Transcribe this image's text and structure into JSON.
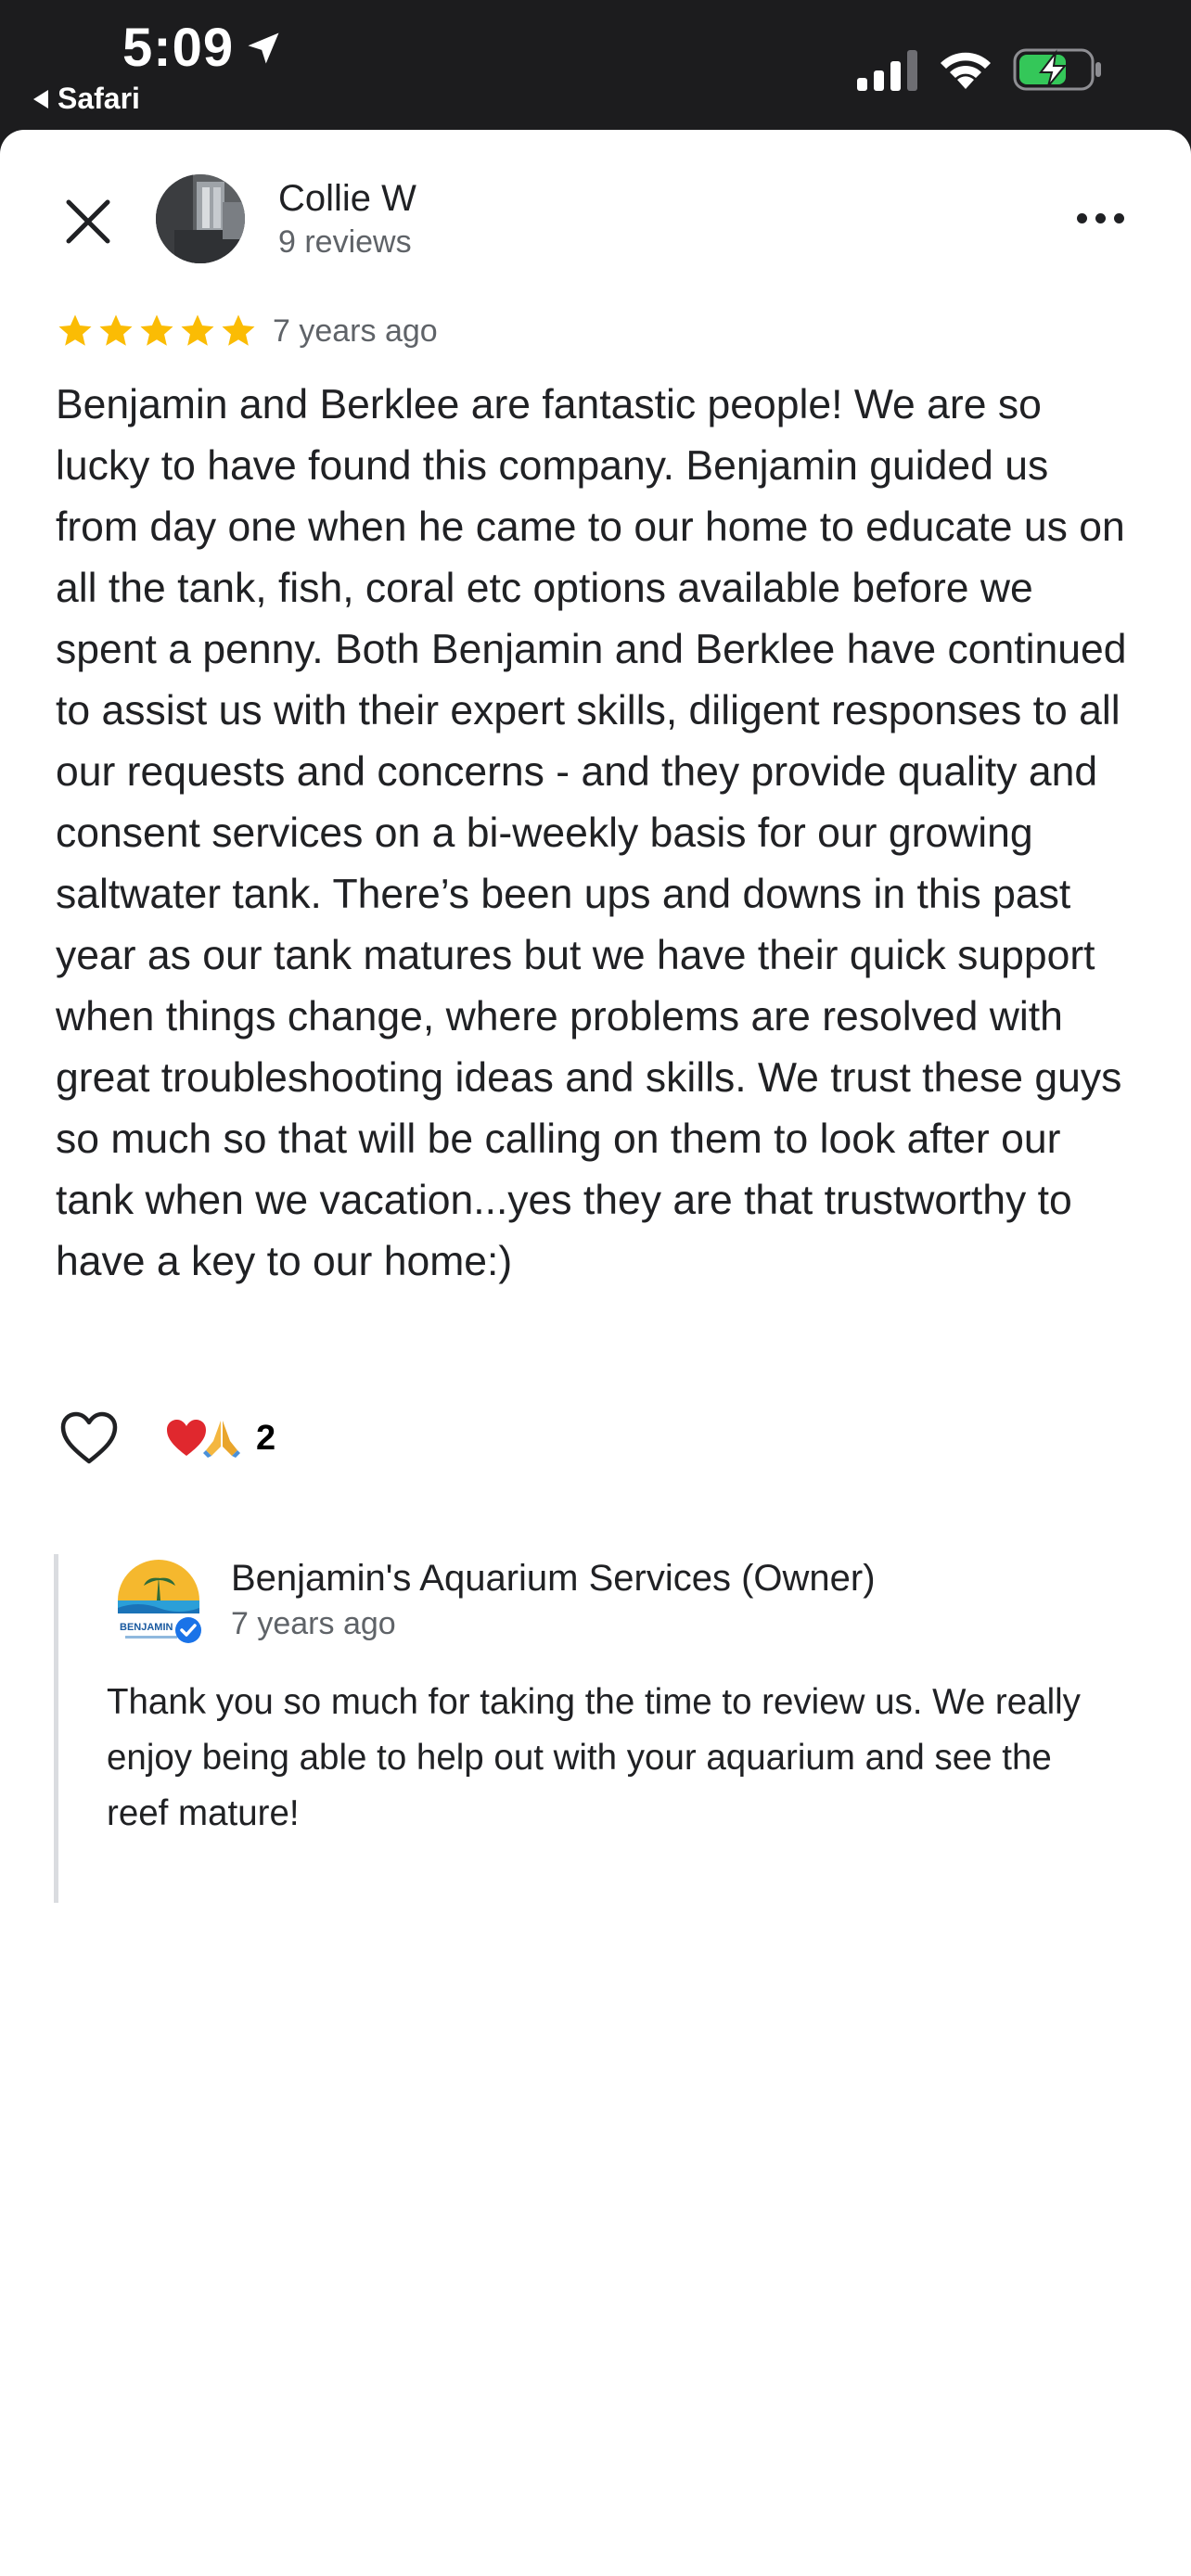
{
  "status_bar": {
    "time": "5:09",
    "back_app": "Safari"
  },
  "review": {
    "reviewer_name": "Collie W",
    "reviewer_reviews": "9 reviews",
    "rating": 5,
    "max_rating": 5,
    "age": "7 years ago",
    "text": "Benjamin and Berklee are fantastic people! We are so lucky to have found this company. Benjamin guided us from day one when he came to our home to educate us on all the tank, fish, coral etc options available before we spent a penny. Both Benjamin and Berklee have continued to assist us with their expert skills, diligent responses to all our requests and concerns - and they provide quality and consent services on a bi-weekly basis for our growing saltwater tank. There’s been ups and downs in this past year as our tank matures but we have their quick support when things change, where problems are resolved with great troubleshooting ideas and skills. We trust these guys so much so that will be calling on them to look after our tank when we vacation...yes they are that trustworthy to have a key to our home:)",
    "reaction_count": "2",
    "reaction_icons": [
      "heart-emoji",
      "praying-hands-emoji"
    ]
  },
  "owner_reply": {
    "name": "Benjamin's Aquarium Services (Owner)",
    "age": "7 years ago",
    "text": "Thank you so much for taking the time to review us. We really enjoy being able to help out with your aquarium and see the reef mature!",
    "logo_text": "BENJAMIN"
  },
  "colors": {
    "star": "#fbbc04",
    "verified": "#1a73e8",
    "battery_charge": "#34c759",
    "text_primary": "#202124",
    "text_secondary": "#5f6368"
  }
}
